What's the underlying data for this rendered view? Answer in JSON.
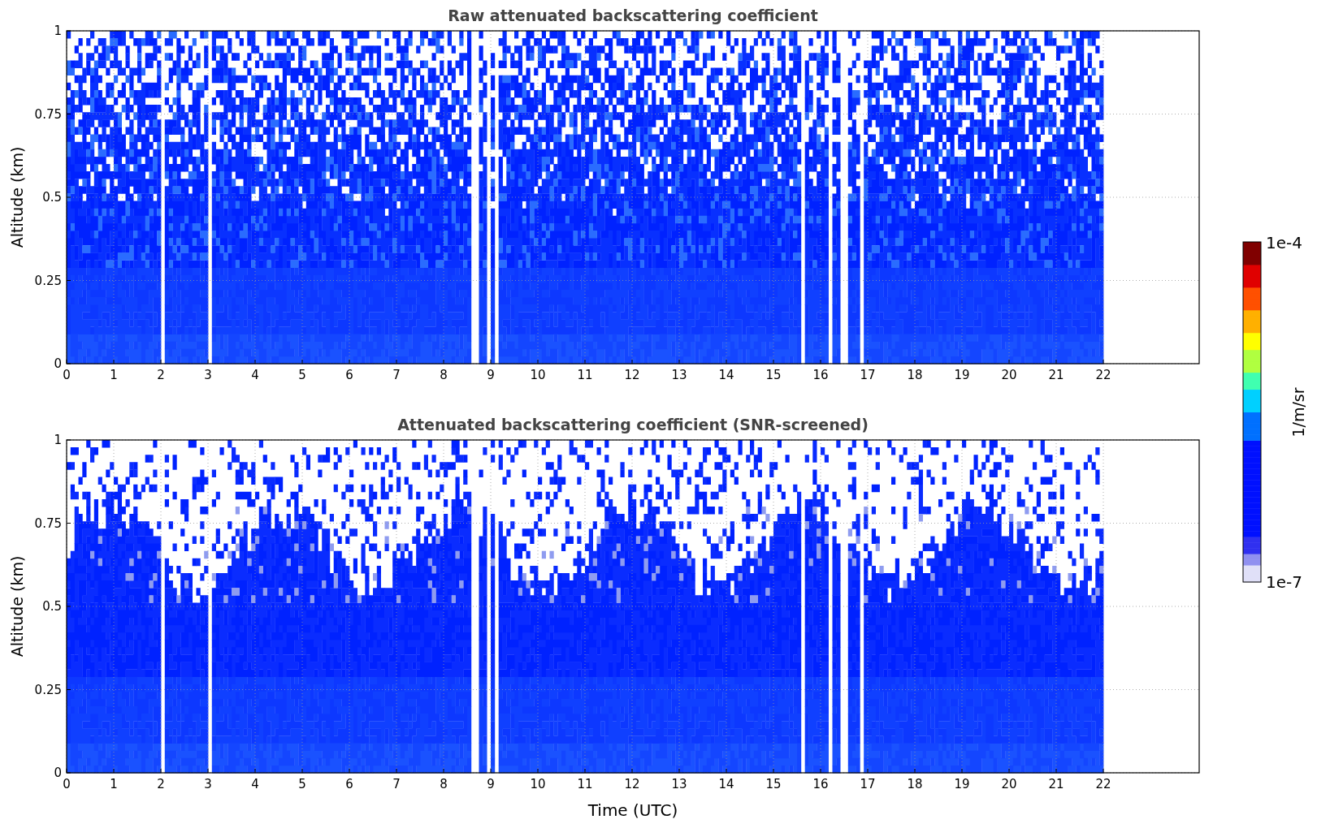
{
  "panels": [
    {
      "kind": "raw",
      "title": "Raw attenuated backscattering coefficient",
      "ylabel": "Altitude (km)",
      "yticks": [
        "1",
        "0.75",
        "0.5",
        "0.25",
        "0"
      ],
      "xticks": [
        "0",
        "1",
        "2",
        "3",
        "4",
        "5",
        "6",
        "7",
        "8",
        "9",
        "10",
        "11",
        "12",
        "13",
        "14",
        "15",
        "16",
        "17",
        "18",
        "19",
        "20",
        "21",
        "22"
      ]
    },
    {
      "kind": "screened",
      "title": "Attenuated backscattering coefficient (SNR-screened)",
      "ylabel": "Altitude (km)",
      "yticks": [
        "1",
        "0.75",
        "0.5",
        "0.25",
        "0"
      ],
      "xticks": [
        "0",
        "1",
        "2",
        "3",
        "4",
        "5",
        "6",
        "7",
        "8",
        "9",
        "10",
        "11",
        "12",
        "13",
        "14",
        "15",
        "16",
        "17",
        "18",
        "19",
        "20",
        "21",
        "22"
      ]
    }
  ],
  "xlabel": "Time (UTC)",
  "colorbar": {
    "max_label": "1e-4",
    "min_label": "1e-7",
    "unit": "1/m/sr"
  }
}
